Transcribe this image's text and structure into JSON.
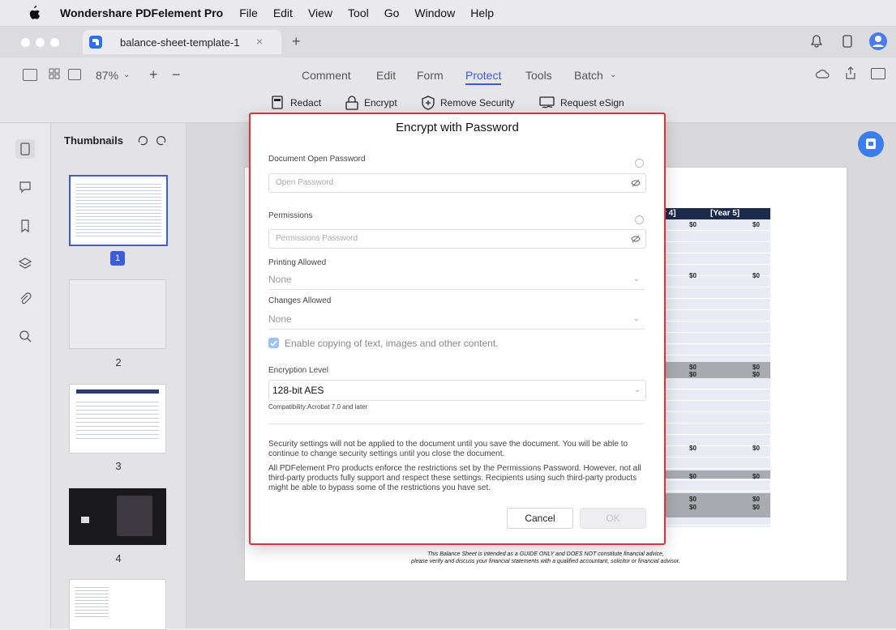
{
  "menubar": {
    "app_name": "Wondershare PDFelement Pro",
    "items": [
      "File",
      "Edit",
      "View",
      "Tool",
      "Go",
      "Window",
      "Help"
    ]
  },
  "tabbar": {
    "tab_title": "balance-sheet-template-1",
    "close": "×",
    "new_tab": "+"
  },
  "toolbar": {
    "zoom": "87%",
    "zoom_in": "+",
    "zoom_out": "−",
    "tabs": [
      "Comment",
      "Edit",
      "Form",
      "Protect",
      "Tools",
      "Batch"
    ],
    "active_tab": "Protect",
    "batch_chevron": "⌄",
    "subtools": [
      "Redact",
      "Encrypt",
      "Remove Security",
      "Request eSign"
    ]
  },
  "thumbnails": {
    "title": "Thumbnails",
    "pages": [
      "1",
      "2",
      "3",
      "4"
    ]
  },
  "dialog": {
    "title": "Encrypt with Password",
    "open_password_label": "Document Open Password",
    "open_password_placeholder": "Open Password",
    "permissions_label": "Permissions",
    "permissions_placeholder": "Permissions Password",
    "printing_label": "Printing Allowed",
    "printing_value": "None",
    "changes_label": "Changes Allowed",
    "changes_value": "None",
    "copy_checkbox_label": "Enable copying of text, images and other content.",
    "encryption_label": "Encryption Level",
    "encryption_value": "128-bit AES",
    "compatibility": "Compatibility:Acrobat 7.0 and later",
    "note1": "Security settings will not be applied to the document until you save the document. You will be able to continue to change security settings until you close the document.",
    "note2": "All PDFelement Pro products enforce the restrictions set by the Permissions Password. However, not all third-party products fully support and respect these settings. Recipients using such third-party products might be able to bypass some of the restrictions you have set.",
    "cancel": "Cancel",
    "ok": "OK"
  },
  "document": {
    "col_year4": "r 4]",
    "col_year5": "[Year 5]",
    "rows": [
      [
        "$0",
        "$0"
      ],
      [
        "$0",
        "$0"
      ],
      [
        "$0",
        "$0"
      ],
      [
        "$0",
        "$0"
      ],
      [
        "$0",
        "$0"
      ],
      [
        "$0",
        "$0"
      ],
      [
        "$0",
        "$0"
      ],
      [
        "$0",
        "$0"
      ]
    ],
    "footer1": "This Balance Sheet is intended as a GUIDE ONLY and DOES NOT constitute financial advice,",
    "footer2": "please verify and discuss your financial statements with a qualified accountant, solicitor or financial advisor."
  },
  "colors": {
    "accent": "#3b5bd9",
    "highlight_border": "#d9323a",
    "doc_header": "#1c2b4b"
  }
}
